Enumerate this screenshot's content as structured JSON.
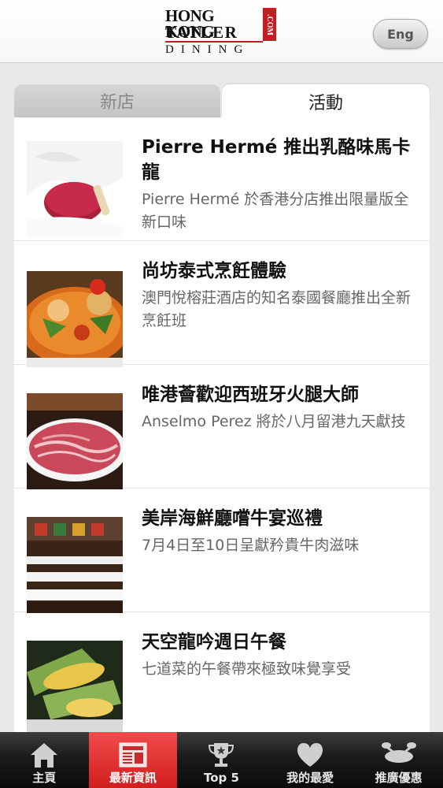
{
  "header": {
    "logo": {
      "line1": "HONG KONG",
      "line2": "TATLER",
      "line3": "DINING",
      "com": ".COM"
    },
    "lang_button": "Eng"
  },
  "tabs": [
    {
      "label": "新店",
      "active": false
    },
    {
      "label": "活動",
      "active": true
    }
  ],
  "items": [
    {
      "title": "Pierre Hermé 推出乳酪味馬卡龍",
      "desc": "Pierre Hermé 於香港分店推出限量版全新口味",
      "image": "macaron-photo"
    },
    {
      "title": "尚坊泰式烹飪體驗",
      "desc": "澳門悅榕莊酒店的知名泰國餐廳推出全新烹飪班",
      "image": "thai-soup-photo"
    },
    {
      "title": "唯港薈歡迎西班牙火腿大師",
      "desc": "Anselmo Perez 將於八月留港九天獻技",
      "image": "ham-plate-photo"
    },
    {
      "title": "美岸海鮮廳嚐牛宴巡禮",
      "desc": "7月4日至10日呈獻矜貴牛肉滋味",
      "image": "restaurant-interior-photo"
    },
    {
      "title": "天空龍吟週日午餐",
      "desc": "七道菜的午餐帶來極致味覺享受",
      "image": "corn-dish-photo"
    }
  ],
  "tabbar": [
    {
      "label": "主頁",
      "icon": "home-icon",
      "active": false
    },
    {
      "label": "最新資訊",
      "icon": "news-icon",
      "active": true
    },
    {
      "label": "Top 5",
      "icon": "trophy-icon",
      "active": false
    },
    {
      "label": "我的最愛",
      "icon": "heart-icon",
      "active": false
    },
    {
      "label": "推廣優惠",
      "icon": "dining-icon",
      "active": false
    }
  ],
  "colors": {
    "brand_red": "#c61d23",
    "active_tab_red": "#e23535"
  }
}
